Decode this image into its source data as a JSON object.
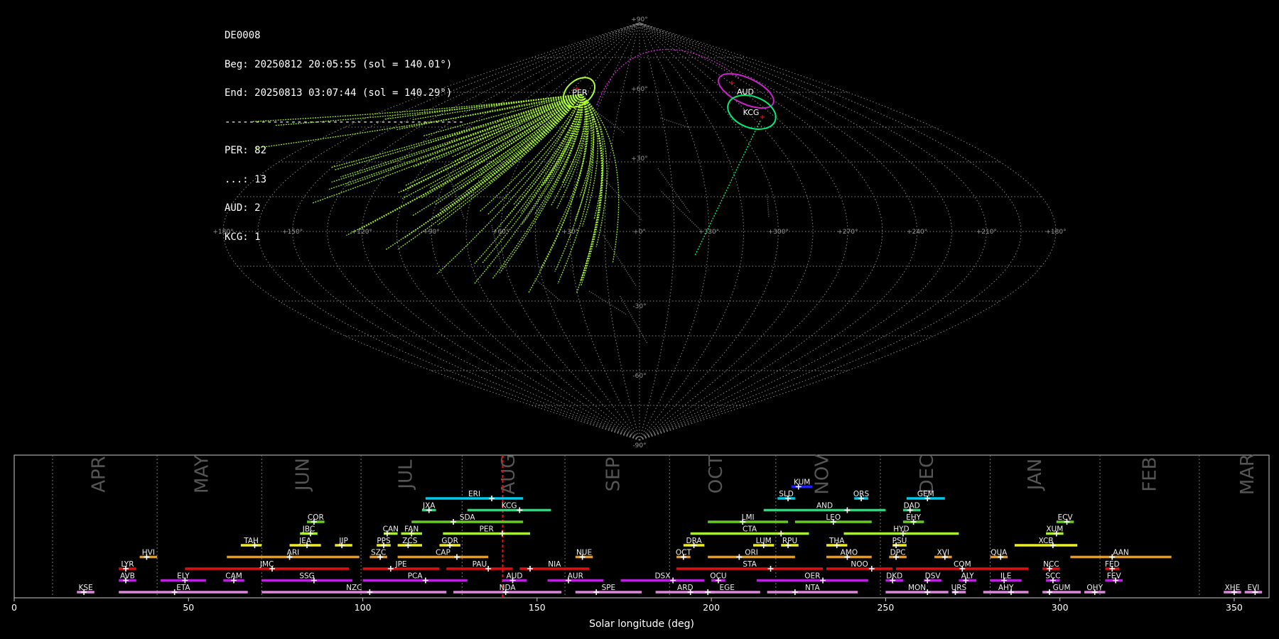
{
  "info": {
    "station": "DE0008",
    "beg": "Beg: 20250812 20:05:55 (sol = 140.01°)",
    "end": "End: 20250813 03:07:44 (sol = 140.29°)",
    "sep": "----------------------------------------",
    "counts": [
      "PER: 82",
      "...: 13",
      "AUD: 2",
      "KCG: 1"
    ]
  },
  "sky_map": {
    "lon_labels": [
      "+180°",
      "+150°",
      "+120°",
      "+90°",
      "+60°",
      "+30°",
      "+0°",
      "+330°",
      "+300°",
      "+270°",
      "+240°",
      "+210°",
      "+180°"
    ],
    "lat_labels": [
      "+90°",
      "+60°",
      "+30°",
      "-30°",
      "-60°",
      "-90°"
    ],
    "radiants": [
      {
        "name": "PER",
        "color": "#adff2f"
      },
      {
        "name": "AUD",
        "color": "#cc22cc"
      },
      {
        "name": "KCG",
        "color": "#00ee77"
      }
    ]
  },
  "chart_data": {
    "type": "gantt",
    "xlabel": "Solar longitude (deg)",
    "xlim": [
      0,
      360
    ],
    "xticks": [
      0,
      50,
      100,
      150,
      200,
      250,
      300,
      350
    ],
    "current_sol": 140.15,
    "months": [
      {
        "name": "APR",
        "sol": 24.5,
        "div": 11
      },
      {
        "name": "MAY",
        "sol": 54,
        "div": 41
      },
      {
        "name": "JUN",
        "sol": 83,
        "div": 71
      },
      {
        "name": "JUL",
        "sol": 112.5,
        "div": 99.5
      },
      {
        "name": "AUG",
        "sol": 142,
        "div": 128.5
      },
      {
        "name": "SEP",
        "sol": 172,
        "div": 158
      },
      {
        "name": "OCT",
        "sol": 201.5,
        "div": 188
      },
      {
        "name": "NOV",
        "sol": 232,
        "div": 218.5
      },
      {
        "name": "DEC",
        "sol": 262,
        "div": 248.5
      },
      {
        "name": "JAN",
        "sol": 293,
        "div": 280
      },
      {
        "name": "FEB",
        "sol": 326,
        "div": 311.5
      },
      {
        "name": "MAR",
        "sol": 354,
        "div": 340
      }
    ],
    "showers": [
      {
        "code": "KUM",
        "row": 9,
        "start": 223,
        "end": 229,
        "peak": 225,
        "color": "#2222ee"
      },
      {
        "code": "ERI",
        "row": 8,
        "start": 118,
        "end": 146,
        "peak": 137,
        "color": "#00ccee"
      },
      {
        "code": "SLD",
        "row": 8,
        "start": 219,
        "end": 224,
        "peak": 222,
        "color": "#00ccee"
      },
      {
        "code": "ORS",
        "row": 8,
        "start": 241,
        "end": 245,
        "peak": 243,
        "color": "#00ccee"
      },
      {
        "code": "GEM",
        "row": 8,
        "start": 256,
        "end": 267,
        "peak": 262,
        "color": "#00ccee"
      },
      {
        "code": "JXA",
        "row": 7,
        "start": 117,
        "end": 121,
        "peak": 119,
        "color": "#22dd77"
      },
      {
        "code": "KCG",
        "row": 7,
        "start": 130,
        "end": 154,
        "peak": 145,
        "color": "#22dd77"
      },
      {
        "code": "AND",
        "row": 7,
        "start": 215,
        "end": 250,
        "peak": 239,
        "color": "#22dd77"
      },
      {
        "code": "DAD",
        "row": 7,
        "start": 255,
        "end": 260,
        "peak": 257,
        "color": "#22dd77"
      },
      {
        "code": "COR",
        "row": 6,
        "start": 84,
        "end": 89,
        "peak": 86,
        "color": "#66cc22"
      },
      {
        "code": "SDA",
        "row": 6,
        "start": 114,
        "end": 146,
        "peak": 126,
        "color": "#66cc22"
      },
      {
        "code": "LMI",
        "row": 6,
        "start": 199,
        "end": 222,
        "peak": 209,
        "color": "#66cc22"
      },
      {
        "code": "LEO",
        "row": 6,
        "start": 224,
        "end": 246,
        "peak": 235,
        "color": "#66cc22"
      },
      {
        "code": "EHY",
        "row": 6,
        "start": 255,
        "end": 261,
        "peak": 258,
        "color": "#66cc22"
      },
      {
        "code": "ECV",
        "row": 6,
        "start": 299,
        "end": 304,
        "peak": 302,
        "color": "#66cc22"
      },
      {
        "code": "JBC",
        "row": 5,
        "start": 82,
        "end": 87,
        "peak": 85,
        "color": "#aaee33"
      },
      {
        "code": "CAN",
        "row": 5,
        "start": 106,
        "end": 110,
        "peak": 107,
        "color": "#aaee33"
      },
      {
        "code": "FAN",
        "row": 5,
        "start": 111,
        "end": 117,
        "peak": 114,
        "color": "#aaee33"
      },
      {
        "code": "PER",
        "row": 5,
        "start": 123,
        "end": 148,
        "peak": 140,
        "color": "#aaee33"
      },
      {
        "code": "CTA",
        "row": 5,
        "start": 194,
        "end": 228,
        "peak": 220,
        "color": "#aaee33"
      },
      {
        "code": "HYD",
        "row": 5,
        "start": 238,
        "end": 271,
        "peak": 255,
        "color": "#aaee33"
      },
      {
        "code": "XUM",
        "row": 5,
        "start": 296,
        "end": 301,
        "peak": 299,
        "color": "#aaee33"
      },
      {
        "code": "TAH",
        "row": 4,
        "start": 65,
        "end": 71,
        "peak": 69,
        "color": "#eeee22"
      },
      {
        "code": "JEA",
        "row": 4,
        "start": 79,
        "end": 88,
        "peak": 84,
        "color": "#eeee22"
      },
      {
        "code": "JIP",
        "row": 4,
        "start": 92,
        "end": 97,
        "peak": 94,
        "color": "#eeee22"
      },
      {
        "code": "PPS",
        "row": 4,
        "start": 104,
        "end": 108,
        "peak": 106,
        "color": "#eeee22"
      },
      {
        "code": "ZCS",
        "row": 4,
        "start": 110,
        "end": 117,
        "peak": 113,
        "color": "#eeee22"
      },
      {
        "code": "GDR",
        "row": 4,
        "start": 122,
        "end": 128,
        "peak": 125,
        "color": "#eeee22"
      },
      {
        "code": "DRA",
        "row": 4,
        "start": 192,
        "end": 198,
        "peak": 195,
        "color": "#eeee22"
      },
      {
        "code": "LUM",
        "row": 4,
        "start": 212,
        "end": 218,
        "peak": 215,
        "color": "#eeee22"
      },
      {
        "code": "RPU",
        "row": 4,
        "start": 220,
        "end": 225,
        "peak": 222,
        "color": "#eeee22"
      },
      {
        "code": "THA",
        "row": 4,
        "start": 233,
        "end": 239,
        "peak": 236,
        "color": "#eeee22"
      },
      {
        "code": "PSU",
        "row": 4,
        "start": 252,
        "end": 256,
        "peak": 253,
        "color": "#eeee22"
      },
      {
        "code": "XCB",
        "row": 4,
        "start": 287,
        "end": 305,
        "peak": 298,
        "color": "#eeee22"
      },
      {
        "code": "HVI",
        "row": 3,
        "start": 36,
        "end": 41,
        "peak": 38,
        "color": "#ee9911"
      },
      {
        "code": "ARI",
        "row": 3,
        "start": 61,
        "end": 99,
        "peak": 79,
        "color": "#ee9911"
      },
      {
        "code": "SZC",
        "row": 3,
        "start": 102,
        "end": 107,
        "peak": 105,
        "color": "#ee9911"
      },
      {
        "code": "CAP",
        "row": 3,
        "start": 110,
        "end": 136,
        "peak": 127,
        "color": "#ee9911"
      },
      {
        "code": "NUE",
        "row": 3,
        "start": 161,
        "end": 166,
        "peak": 163,
        "color": "#ee9911"
      },
      {
        "code": "OCT",
        "row": 3,
        "start": 190,
        "end": 194,
        "peak": 192,
        "color": "#ee9911"
      },
      {
        "code": "ORI",
        "row": 3,
        "start": 199,
        "end": 224,
        "peak": 208,
        "color": "#ee9911"
      },
      {
        "code": "AMO",
        "row": 3,
        "start": 233,
        "end": 246,
        "peak": 239,
        "color": "#ee9911"
      },
      {
        "code": "DPC",
        "row": 3,
        "start": 251,
        "end": 256,
        "peak": 253,
        "color": "#ee9911"
      },
      {
        "code": "XVI",
        "row": 3,
        "start": 264,
        "end": 269,
        "peak": 267,
        "color": "#ee9911"
      },
      {
        "code": "QUA",
        "row": 3,
        "start": 280,
        "end": 285,
        "peak": 283,
        "color": "#ee9911"
      },
      {
        "code": "AAN",
        "row": 3,
        "start": 303,
        "end": 332,
        "peak": 315,
        "color": "#ee9911"
      },
      {
        "code": "LYR",
        "row": 2,
        "start": 30,
        "end": 35,
        "peak": 32,
        "color": "#dd1111"
      },
      {
        "code": "JMC",
        "row": 2,
        "start": 49,
        "end": 96,
        "peak": 74,
        "color": "#dd1111"
      },
      {
        "code": "JPE",
        "row": 2,
        "start": 100,
        "end": 122,
        "peak": 108,
        "color": "#dd1111"
      },
      {
        "code": "PAU",
        "row": 2,
        "start": 124,
        "end": 143,
        "peak": 136,
        "color": "#dd1111"
      },
      {
        "code": "NIA",
        "row": 2,
        "start": 145,
        "end": 165,
        "peak": 148,
        "color": "#dd1111"
      },
      {
        "code": "STA",
        "row": 2,
        "start": 190,
        "end": 232,
        "peak": 217,
        "color": "#dd1111"
      },
      {
        "code": "NOO",
        "row": 2,
        "start": 233,
        "end": 252,
        "peak": 246,
        "color": "#dd1111"
      },
      {
        "code": "COM",
        "row": 2,
        "start": 253,
        "end": 291,
        "peak": 272,
        "color": "#dd1111"
      },
      {
        "code": "NCC",
        "row": 2,
        "start": 295,
        "end": 300,
        "peak": 297,
        "color": "#dd1111"
      },
      {
        "code": "FED",
        "row": 2,
        "start": 313,
        "end": 317,
        "peak": 315,
        "color": "#dd1111"
      },
      {
        "code": "AVB",
        "row": 1,
        "start": 30,
        "end": 35,
        "peak": 32,
        "color": "#bb22dd"
      },
      {
        "code": "ELY",
        "row": 1,
        "start": 42,
        "end": 55,
        "peak": 49,
        "color": "#bb22dd"
      },
      {
        "code": "CAM",
        "row": 1,
        "start": 60,
        "end": 66,
        "peak": 63,
        "color": "#bb22dd"
      },
      {
        "code": "SSG",
        "row": 1,
        "start": 71,
        "end": 97,
        "peak": 86,
        "color": "#bb22dd"
      },
      {
        "code": "PCA",
        "row": 1,
        "start": 100,
        "end": 130,
        "peak": 118,
        "color": "#bb22dd"
      },
      {
        "code": "AUD",
        "row": 1,
        "start": 140,
        "end": 147,
        "peak": 143,
        "color": "#bb22dd"
      },
      {
        "code": "AUR",
        "row": 1,
        "start": 153,
        "end": 169,
        "peak": 159,
        "color": "#bb22dd"
      },
      {
        "code": "DSX",
        "row": 1,
        "start": 174,
        "end": 198,
        "peak": 189,
        "color": "#bb22dd"
      },
      {
        "code": "OCU",
        "row": 1,
        "start": 200,
        "end": 204,
        "peak": 202,
        "color": "#bb22dd"
      },
      {
        "code": "OER",
        "row": 1,
        "start": 213,
        "end": 245,
        "peak": 232,
        "color": "#bb22dd"
      },
      {
        "code": "DKD",
        "row": 1,
        "start": 250,
        "end": 255,
        "peak": 252,
        "color": "#bb22dd"
      },
      {
        "code": "DSV",
        "row": 1,
        "start": 261,
        "end": 266,
        "peak": 262,
        "color": "#bb22dd"
      },
      {
        "code": "ALY",
        "row": 1,
        "start": 271,
        "end": 276,
        "peak": 273,
        "color": "#bb22dd"
      },
      {
        "code": "ILE",
        "row": 1,
        "start": 280,
        "end": 289,
        "peak": 284,
        "color": "#bb22dd"
      },
      {
        "code": "SCC",
        "row": 1,
        "start": 296,
        "end": 300,
        "peak": 298,
        "color": "#bb22dd"
      },
      {
        "code": "FEV",
        "row": 1,
        "start": 313,
        "end": 318,
        "peak": 316,
        "color": "#bb22dd"
      },
      {
        "code": "KSE",
        "row": 0,
        "start": 18,
        "end": 23,
        "peak": 20,
        "color": "#dd88dd"
      },
      {
        "code": "ETA",
        "row": 0,
        "start": 30,
        "end": 67,
        "peak": 46,
        "color": "#dd88dd"
      },
      {
        "code": "NZC",
        "row": 0,
        "start": 71,
        "end": 124,
        "peak": 102,
        "color": "#dd88dd"
      },
      {
        "code": "NDA",
        "row": 0,
        "start": 126,
        "end": 157,
        "peak": 141,
        "color": "#dd88dd"
      },
      {
        "code": "SPE",
        "row": 0,
        "start": 161,
        "end": 180,
        "peak": 167,
        "color": "#dd88dd"
      },
      {
        "code": "ARD",
        "row": 0,
        "start": 184,
        "end": 201,
        "peak": 194,
        "color": "#dd88dd"
      },
      {
        "code": "EGE",
        "row": 0,
        "start": 195,
        "end": 214,
        "peak": 199,
        "color": "#dd88dd"
      },
      {
        "code": "NTA",
        "row": 0,
        "start": 216,
        "end": 242,
        "peak": 224,
        "color": "#dd88dd"
      },
      {
        "code": "MON",
        "row": 0,
        "start": 250,
        "end": 268,
        "peak": 262,
        "color": "#dd88dd"
      },
      {
        "code": "URS",
        "row": 0,
        "start": 269,
        "end": 273,
        "peak": 270,
        "color": "#dd88dd"
      },
      {
        "code": "AHY",
        "row": 0,
        "start": 278,
        "end": 291,
        "peak": 286,
        "color": "#dd88dd"
      },
      {
        "code": "GUM",
        "row": 0,
        "start": 295,
        "end": 306,
        "peak": 297,
        "color": "#dd88dd"
      },
      {
        "code": "OHY",
        "row": 0,
        "start": 307,
        "end": 313,
        "peak": 310,
        "color": "#dd88dd"
      },
      {
        "code": "XHE",
        "row": 0,
        "start": 347,
        "end": 352,
        "peak": 350,
        "color": "#dd88dd"
      },
      {
        "code": "EVI",
        "row": 0,
        "start": 353,
        "end": 358,
        "peak": 356,
        "color": "#dd88dd"
      }
    ]
  }
}
